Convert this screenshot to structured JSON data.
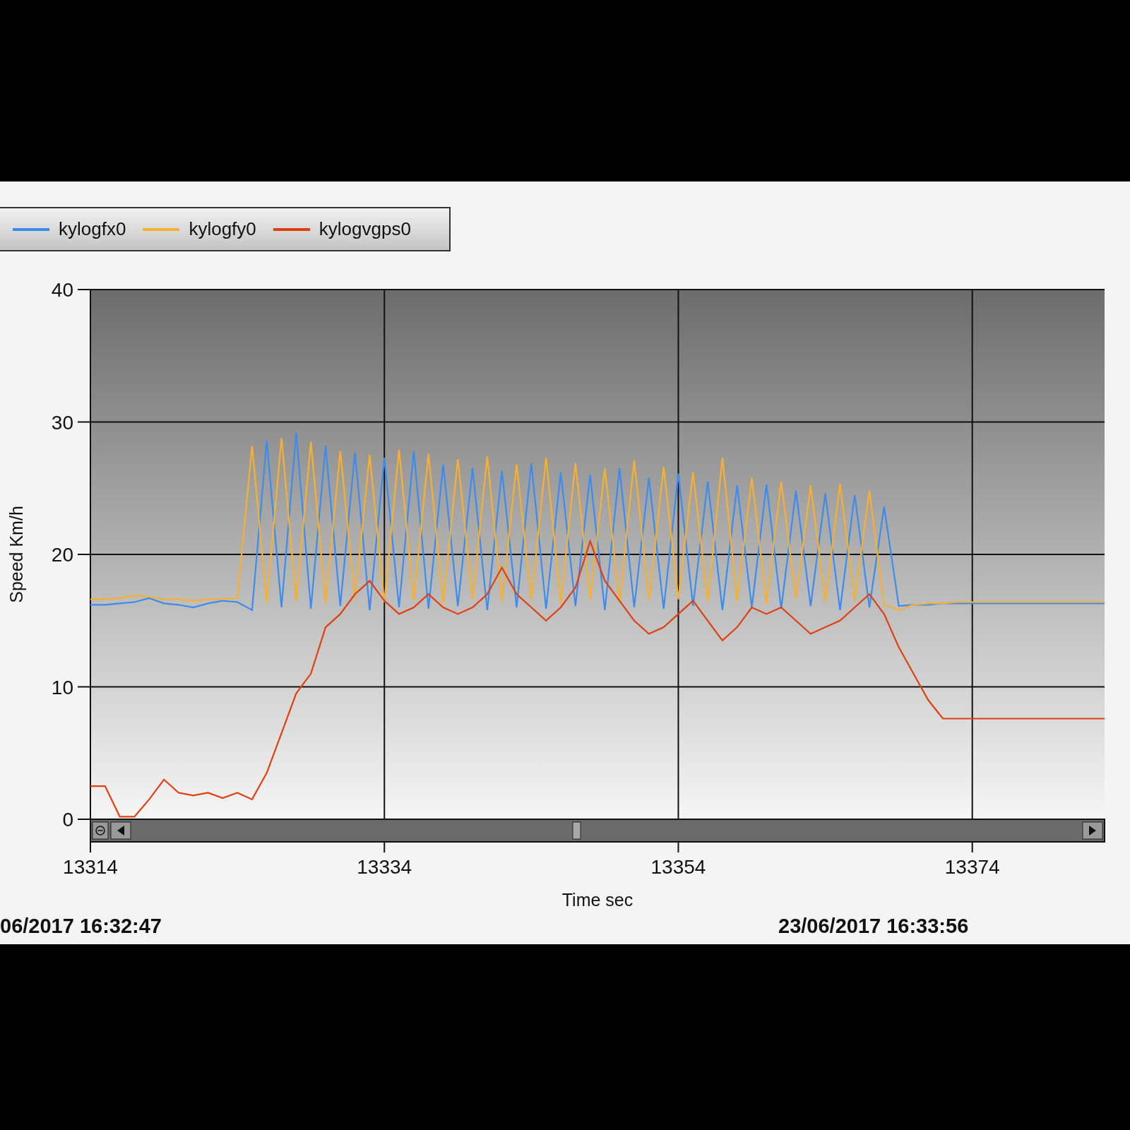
{
  "chart": {
    "chart_data": {
      "type": "line",
      "grid": true,
      "xlabel": "Time sec",
      "ylabel": "Speed Km/h",
      "x": [
        13314,
        13315,
        13316,
        13317,
        13318,
        13319,
        13320,
        13321,
        13322,
        13323,
        13324,
        13325,
        13326,
        13327,
        13328,
        13329,
        13330,
        13331,
        13332,
        13333,
        13334,
        13335,
        13336,
        13337,
        13338,
        13339,
        13340,
        13341,
        13342,
        13343,
        13344,
        13345,
        13346,
        13347,
        13348,
        13349,
        13350,
        13351,
        13352,
        13353,
        13354,
        13355,
        13356,
        13357,
        13358,
        13359,
        13360,
        13361,
        13362,
        13363,
        13364,
        13365,
        13366,
        13367,
        13368,
        13369,
        13370,
        13371,
        13372,
        13373,
        13374,
        13375,
        13376,
        13377,
        13378,
        13379,
        13380,
        13381,
        13382,
        13383
      ],
      "series": [
        {
          "name": "kylogfx0",
          "color": "#3c8cf0",
          "values": [
            16.2,
            16.2,
            16.3,
            16.4,
            16.7,
            16.3,
            16.2,
            16.0,
            16.3,
            16.5,
            16.4,
            15.8,
            28.6,
            16.0,
            29.2,
            15.9,
            28.2,
            16.1,
            27.7,
            15.8,
            27.3,
            16.0,
            27.8,
            15.9,
            26.8,
            16.1,
            26.5,
            15.8,
            26.3,
            16.0,
            26.9,
            15.9,
            26.2,
            16.1,
            26.0,
            15.8,
            26.5,
            16.0,
            25.8,
            15.9,
            26.1,
            16.1,
            25.5,
            15.8,
            25.2,
            16.0,
            25.3,
            15.9,
            24.8,
            16.1,
            24.6,
            15.8,
            24.5,
            16.0,
            23.6,
            16.1,
            16.2,
            16.2,
            16.3,
            16.3,
            16.3,
            16.3,
            16.3,
            16.3,
            16.3,
            16.3,
            16.3,
            16.3,
            16.3,
            16.3
          ]
        },
        {
          "name": "kylogfy0",
          "color": "#f8b030",
          "values": [
            16.6,
            16.6,
            16.7,
            16.9,
            16.8,
            16.6,
            16.6,
            16.5,
            16.6,
            16.6,
            16.7,
            28.2,
            16.4,
            28.8,
            16.5,
            28.5,
            16.3,
            27.8,
            16.6,
            27.5,
            16.4,
            27.9,
            16.5,
            27.6,
            16.3,
            27.2,
            16.6,
            27.4,
            16.4,
            26.8,
            16.5,
            27.3,
            16.3,
            26.9,
            16.6,
            26.5,
            16.4,
            27.1,
            16.5,
            26.6,
            16.6,
            26.2,
            16.4,
            27.3,
            16.5,
            25.8,
            16.3,
            25.5,
            16.6,
            25.2,
            16.4,
            25.3,
            16.5,
            24.8,
            16.2,
            15.8,
            16.2,
            16.3,
            16.3,
            16.4,
            16.4,
            16.4,
            16.4,
            16.4,
            16.4,
            16.4,
            16.4,
            16.4,
            16.4,
            16.4
          ]
        },
        {
          "name": "kylogvgps0",
          "color": "#e04010",
          "values": [
            2.5,
            2.5,
            0.2,
            0.2,
            1.5,
            3.0,
            2.0,
            1.8,
            2.0,
            1.6,
            2.0,
            1.5,
            3.5,
            6.5,
            9.5,
            11,
            14.5,
            15.5,
            17,
            18,
            16.5,
            15.5,
            16,
            17,
            16,
            15.5,
            16,
            17,
            19,
            17,
            16,
            15,
            16,
            17.5,
            21,
            18,
            16.5,
            15,
            14,
            14.5,
            15.5,
            16.5,
            15,
            13.5,
            14.5,
            16,
            15.5,
            16,
            15,
            14,
            14.5,
            15,
            16,
            17,
            15.5,
            13,
            11,
            9,
            7.6,
            7.6,
            7.6,
            7.6,
            7.6,
            7.6,
            7.6,
            7.6,
            7.6,
            7.6,
            7.6,
            7.6
          ]
        }
      ],
      "xlim": [
        13314,
        13383
      ],
      "ylim": [
        0,
        40
      ],
      "xticks": [
        13314,
        13334,
        13354,
        13374
      ],
      "yticks": [
        0,
        10,
        20,
        30,
        40
      ]
    }
  },
  "timestamps": {
    "start": "06/2017 16:32:47",
    "end": "23/06/2017 16:33:56"
  }
}
